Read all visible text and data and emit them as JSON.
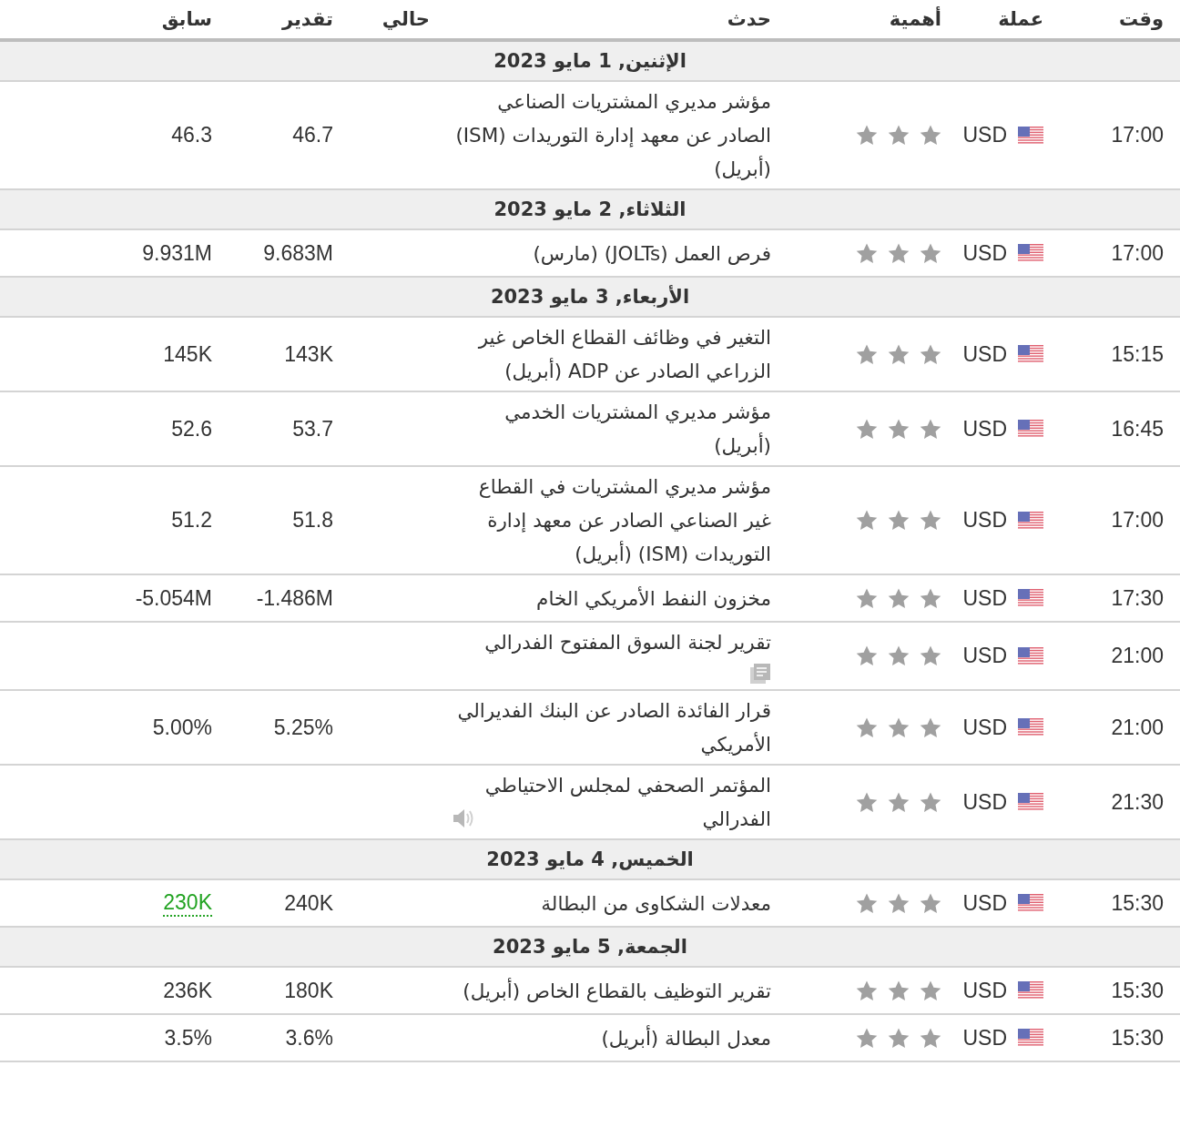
{
  "columns": [
    "وقت",
    "عملة",
    "أهمية",
    "حدث",
    "حالي",
    "تقدير",
    "سابق"
  ],
  "days": [
    {
      "date": "الإثنين, 1 مايو 2023",
      "events": [
        {
          "time": "17:00",
          "currency": "USD",
          "stars": 3,
          "event": "مؤشر مديري المشتريات الصناعي الصادر عن معهد إدارة التوريدات (ISM) (أبريل)",
          "forecast": "46.7",
          "previous": "46.3",
          "previous_revised": false
        }
      ]
    },
    {
      "date": "الثلاثاء, 2 مايو 2023",
      "events": [
        {
          "time": "17:00",
          "currency": "USD",
          "stars": 3,
          "event": "فرص العمل (JOLTs) (مارس)",
          "forecast": "9.683M",
          "previous": "9.931M",
          "previous_revised": false
        }
      ]
    },
    {
      "date": "الأربعاء, 3 مايو 2023",
      "events": [
        {
          "time": "15:15",
          "currency": "USD",
          "stars": 3,
          "event": "التغير في وظائف القطاع الخاص غير الزراعي الصادر عن ADP (أبريل)",
          "forecast": "143K",
          "previous": "145K",
          "previous_revised": false
        },
        {
          "time": "16:45",
          "currency": "USD",
          "stars": 3,
          "event": "مؤشر مديري المشتريات الخدمي (أبريل)",
          "forecast": "53.7",
          "previous": "52.6",
          "previous_revised": false
        },
        {
          "time": "17:00",
          "currency": "USD",
          "stars": 3,
          "event": "مؤشر مديري المشتريات في القطاع غير الصناعي الصادر عن معهد إدارة التوريدات (ISM) (أبريل)",
          "forecast": "51.8",
          "previous": "51.2",
          "previous_revised": false
        },
        {
          "time": "17:30",
          "currency": "USD",
          "stars": 3,
          "event": "مخزون النفط الأمريكي الخام",
          "forecast": "-1.486M",
          "previous": "-5.054M",
          "previous_revised": false
        },
        {
          "time": "21:00",
          "currency": "USD",
          "stars": 3,
          "event": "تقرير لجنة السوق المفتوح الفدرالي",
          "kind": "document"
        },
        {
          "time": "21:00",
          "currency": "USD",
          "stars": 3,
          "event": "قرار الفائدة الصادر عن البنك الفديرالي الأمريكي",
          "forecast": "5.25%",
          "previous": "5.00%",
          "previous_revised": false
        },
        {
          "time": "21:30",
          "currency": "USD",
          "stars": 3,
          "event": "المؤتمر الصحفي لمجلس الاحتياطي الفدرالي",
          "kind": "speech"
        }
      ]
    },
    {
      "date": "الخميس, 4 مايو 2023",
      "events": [
        {
          "time": "15:30",
          "currency": "USD",
          "stars": 3,
          "event": "معدلات الشكاوى من البطالة",
          "forecast": "240K",
          "previous": "230K",
          "previous_revised": true
        }
      ]
    },
    {
      "date": "الجمعة, 5 مايو 2023",
      "events": [
        {
          "time": "15:30",
          "currency": "USD",
          "stars": 3,
          "event": "تقرير التوظيف بالقطاع الخاص (أبريل)",
          "forecast": "180K",
          "previous": "236K",
          "previous_revised": false
        },
        {
          "time": "15:30",
          "currency": "USD",
          "stars": 3,
          "event": "معدل البطالة (أبريل)",
          "forecast": "3.6%",
          "previous": "3.5%",
          "previous_revised": false
        }
      ]
    }
  ]
}
